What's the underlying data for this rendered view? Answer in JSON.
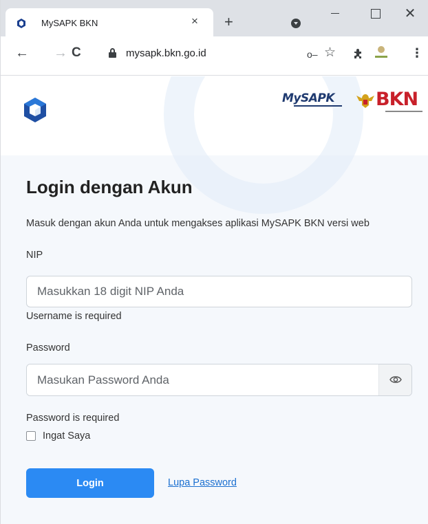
{
  "browser": {
    "tab_title": "MySAPK BKN",
    "tab_close": "×",
    "new_tab": "+",
    "window_close": "✕",
    "url": "mysapk.bkn.go.id",
    "back": "←",
    "forward": "→",
    "reload": "C",
    "key": "o‒",
    "star": "☆",
    "menu": "⋮"
  },
  "header": {
    "mysapk_logo_text": "MySAPK",
    "bkn_logo_text": "BKN"
  },
  "login": {
    "title": "Login dengan Akun",
    "subtitle": "Masuk dengan akun Anda untuk mengakses aplikasi MySAPK BKN versi web",
    "nip_label": "NIP",
    "nip_placeholder": "Masukkan 18 digit NIP Anda",
    "nip_error": "Username is required",
    "password_label": "Password",
    "password_placeholder": "Masukan Password Anda",
    "password_error": "Password is required",
    "remember_label": "Ingat Saya",
    "login_button": "Login",
    "forgot_link": "Lupa Password"
  },
  "colors": {
    "primary": "#2b8af3",
    "link": "#1a6fd0",
    "bkn_red": "#c8202a",
    "mysapk_navy": "#1f3a70",
    "body_bg": "#f5f8fc"
  },
  "icons": [
    "app-favicon-icon",
    "lock-icon",
    "key-icon",
    "star-icon",
    "extension-icon",
    "profile-avatar",
    "eye-icon",
    "garuda-icon"
  ]
}
